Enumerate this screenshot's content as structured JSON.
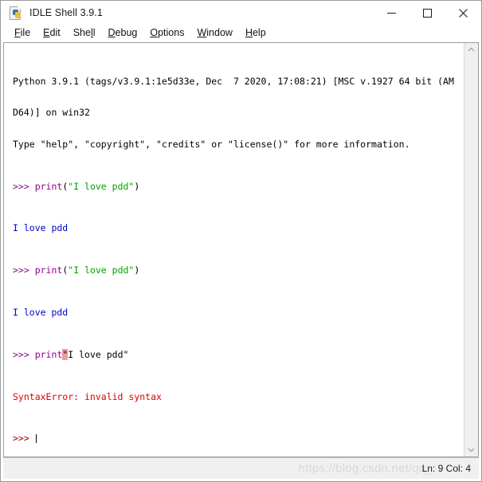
{
  "window": {
    "title": "IDLE Shell 3.9.1",
    "icon": "idle-python-file-icon",
    "controls": {
      "minimize": "minimize-icon",
      "maximize": "maximize-icon",
      "close": "close-icon"
    }
  },
  "menubar": {
    "items": [
      {
        "label": "File",
        "accel": "F"
      },
      {
        "label": "Edit",
        "accel": "E"
      },
      {
        "label": "Shell",
        "accel": "l"
      },
      {
        "label": "Debug",
        "accel": "D"
      },
      {
        "label": "Options",
        "accel": "O"
      },
      {
        "label": "Window",
        "accel": "W"
      },
      {
        "label": "Help",
        "accel": "H"
      }
    ]
  },
  "shell": {
    "banner_line_1": "Python 3.9.1 (tags/v3.9.1:1e5d33e, Dec  7 2020, 17:08:21) [MSC v.1927 64 bit (AM",
    "banner_line_2": "D64)] on win32",
    "banner_line_3": "Type \"help\", \"copyright\", \"credits\" or \"license()\" for more information.",
    "prompt": ">>> ",
    "entries": [
      {
        "type": "input",
        "prompt": ">>> ",
        "func": "print",
        "open_paren": "(",
        "string": "\"I love pdd\"",
        "close_paren": ")"
      },
      {
        "type": "output",
        "text": "I love pdd"
      },
      {
        "type": "input",
        "prompt": ">>> ",
        "func": "print",
        "open_paren": "(",
        "string": "\"I love pdd\"",
        "close_paren": ")"
      },
      {
        "type": "output",
        "text": "I love pdd"
      },
      {
        "type": "error_input",
        "prompt": ">>> ",
        "func": "print",
        "highlighted_char": "\"",
        "rest": "I love pdd\""
      },
      {
        "type": "error",
        "text": "SyntaxError: invalid syntax"
      }
    ],
    "final_prompt": ">>> "
  },
  "scrollbar": {
    "up_arrow": "chevron-up-icon",
    "down_arrow": "chevron-down-icon"
  },
  "statusbar": {
    "position": "Ln: 9  Col: 4",
    "watermark": "https://blog.csdn.net/qq_"
  },
  "colors": {
    "prompt_purple": "#900090",
    "keyword_purple": "#900090",
    "string_green": "#00a000",
    "output_blue": "#0000cc",
    "error_red": "#e00000",
    "highlight_pink": "#f49a9a",
    "window_bg": "#ffffff",
    "chrome_gray": "#f0f0f0"
  }
}
